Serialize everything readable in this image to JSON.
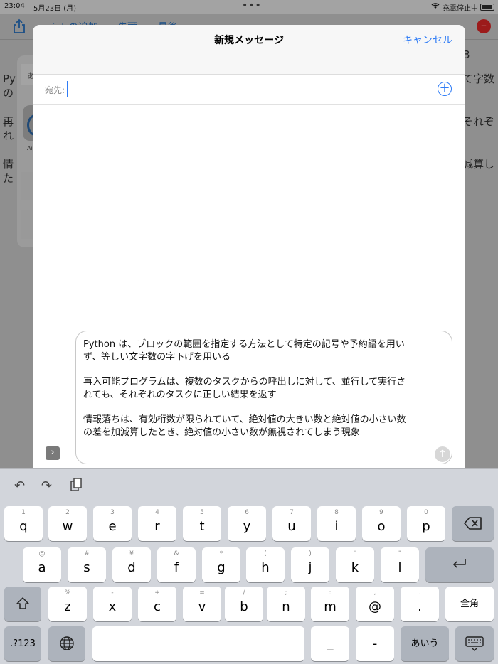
{
  "status_bar": {
    "time": "23:04",
    "date": "5月23日 (月)",
    "dots": "•••",
    "wifi_icon": "wifi-icon",
    "charge_status": "充電停止中",
    "battery_icon": "battery-icon"
  },
  "background": {
    "toolbar": {
      "item1": "point の追加",
      "item2": "先頭",
      "item3": "最後"
    },
    "text_lines": [
      "Py",
      "の",
      "再",
      "れ",
      "情",
      "た",
      "て字数",
      "それぞ",
      "減算し",
      "3",
      "あ",
      "Ai"
    ]
  },
  "compose": {
    "title": "新規メッセージ",
    "cancel": "キャンセル",
    "to_label": "宛先:",
    "to_value": "",
    "message_paragraphs": [
      [
        "Python は、ブロックの範囲を指定する方法として特定の記号や予約語を用い",
        "ず、等しい文字数の字下げを用いる"
      ],
      [
        "再入可能プログラムは、複数のタスクからの呼出しに対して、並行して実行さ",
        "れても、それぞれのタスクに正しい結果を返す"
      ],
      [
        "情報落ちは、有効桁数が限られていて、絶対値の大きい数と絶対値の小さい数",
        "の差を加減算したとき、絶対値の小さい数が無視されてしまう現象"
      ]
    ],
    "send_icon": "↑",
    "expand_icon": "›"
  },
  "keyboard": {
    "toolbar": {
      "undo": "↶",
      "redo": "↷",
      "clipboard": "clipboard-icon"
    },
    "row1": [
      {
        "alt": "1",
        "main": "q"
      },
      {
        "alt": "2",
        "main": "w"
      },
      {
        "alt": "3",
        "main": "e"
      },
      {
        "alt": "4",
        "main": "r"
      },
      {
        "alt": "5",
        "main": "t"
      },
      {
        "alt": "6",
        "main": "y"
      },
      {
        "alt": "7",
        "main": "u"
      },
      {
        "alt": "8",
        "main": "i"
      },
      {
        "alt": "9",
        "main": "o"
      },
      {
        "alt": "0",
        "main": "p"
      }
    ],
    "row2": [
      {
        "alt": "@",
        "main": "a"
      },
      {
        "alt": "#",
        "main": "s"
      },
      {
        "alt": "¥",
        "main": "d"
      },
      {
        "alt": "&",
        "main": "f"
      },
      {
        "alt": "*",
        "main": "g"
      },
      {
        "alt": "(",
        "main": "h"
      },
      {
        "alt": ")",
        "main": "j"
      },
      {
        "alt": "'",
        "main": "k"
      },
      {
        "alt": "\"",
        "main": "l"
      }
    ],
    "row3": [
      {
        "alt": "%",
        "main": "z"
      },
      {
        "alt": "-",
        "main": "x"
      },
      {
        "alt": "+",
        "main": "c"
      },
      {
        "alt": "=",
        "main": "v"
      },
      {
        "alt": "/",
        "main": "b"
      },
      {
        "alt": ";",
        "main": "n"
      },
      {
        "alt": ":",
        "main": "m"
      },
      {
        "alt": ",",
        "main": "@"
      },
      {
        "alt": ".",
        "main": "."
      }
    ],
    "full_width": "全角",
    "num_switch": ".?123",
    "underscore": "_",
    "hyphen": "-",
    "kana": "あいう"
  }
}
